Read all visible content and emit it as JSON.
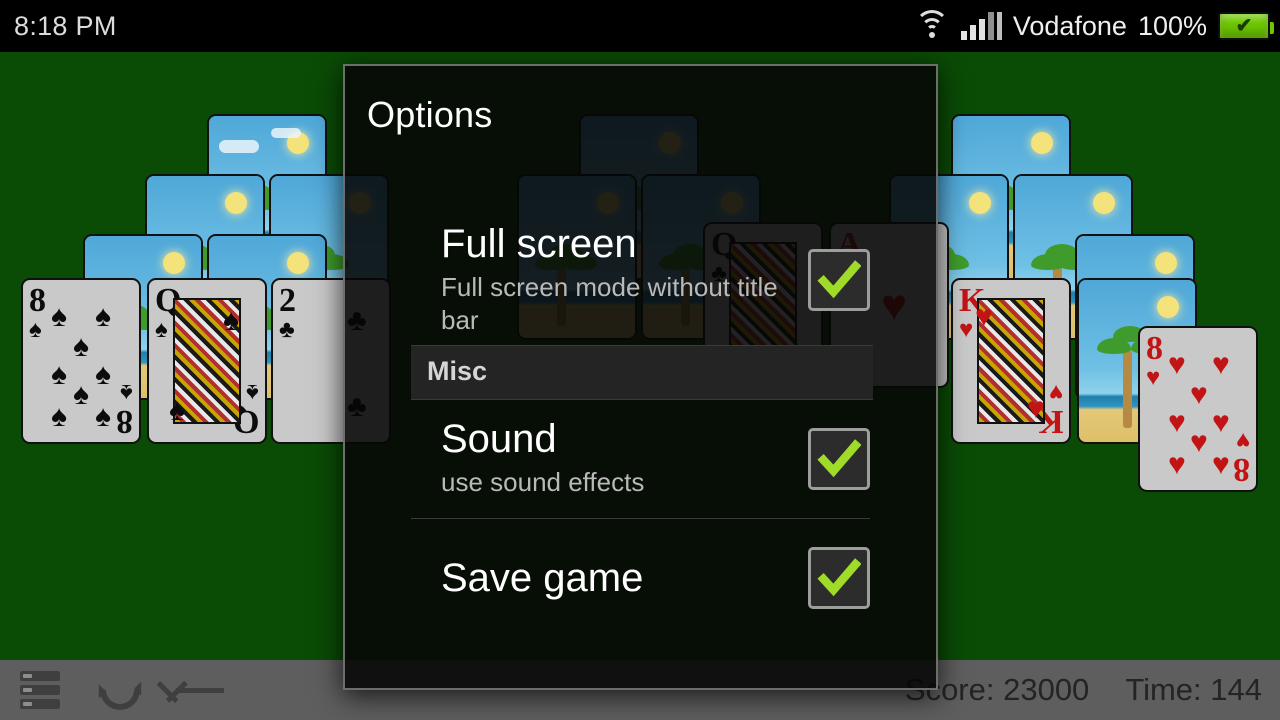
{
  "status_bar": {
    "clock": "8:18 PM",
    "carrier": "Vodafone",
    "battery_percent": "100%",
    "battery_glyph": "✔",
    "icons": [
      "wifi-icon",
      "cellular-signal-icon",
      "battery-icon"
    ]
  },
  "dialog": {
    "title": "Options",
    "items": [
      {
        "title": "Full screen",
        "subtitle": "Full screen mode without title bar",
        "checked": true
      },
      {
        "title": "Sound",
        "subtitle": "use sound effects",
        "checked": true
      },
      {
        "title": "Save game",
        "subtitle": "",
        "checked": true
      }
    ],
    "section_header": "Misc"
  },
  "bottom_bar": {
    "buttons": [
      "menu-icon",
      "restart-icon",
      "back-icon"
    ],
    "score_label": "Score: 23000",
    "time_label": "Time: 144"
  },
  "game": {
    "background_color": "#0a4b06",
    "accent_color": "#9FDB28",
    "face_cards": [
      {
        "rank": "8",
        "suit": "♠",
        "color": "black"
      },
      {
        "rank": "Q",
        "suit": "♠",
        "color": "black"
      },
      {
        "rank": "2",
        "suit": "♣",
        "color": "black"
      },
      {
        "rank": "Q",
        "suit": "♣",
        "color": "black"
      },
      {
        "rank": "A",
        "suit": "♥",
        "color": "red"
      },
      {
        "rank": "K",
        "suit": "♥",
        "color": "red"
      },
      {
        "rank": "8",
        "suit": "♥",
        "color": "red"
      }
    ]
  }
}
